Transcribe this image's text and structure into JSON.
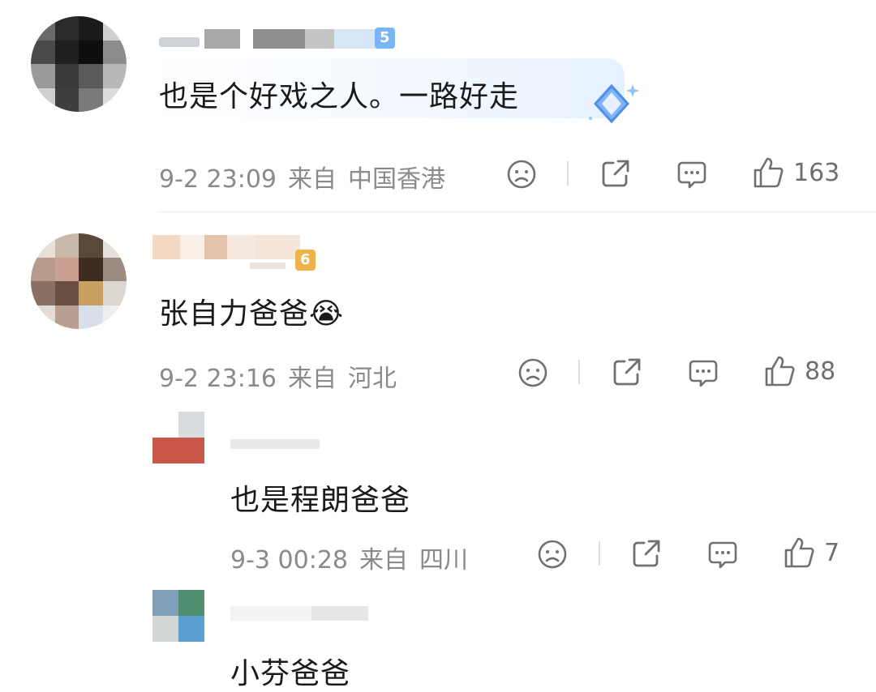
{
  "comments": [
    {
      "content": "也是个好戏之人。一路好走",
      "date": "9-2 23:09",
      "from": "来自",
      "location": "中国香港",
      "likes": "163",
      "badge": "5"
    },
    {
      "content": "张自力爸爸😭",
      "date": "9-2 23:16",
      "from": "来自",
      "location": "河北",
      "likes": "88",
      "badge": "6"
    },
    {
      "content": "也是程朗爸爸",
      "date": "9-3 00:28",
      "from": "来自",
      "location": "四川",
      "likes": "7"
    },
    {
      "content": "小芬爸爸"
    }
  ],
  "icons": {
    "dislike": "sad-face-icon",
    "share": "share-icon",
    "reply": "comment-icon",
    "like": "thumbs-up-icon"
  },
  "colors": {
    "meta_text": "#8a8a8a",
    "badge_blue": "#5aa8ff",
    "badge_gold": "#f0b24a"
  }
}
